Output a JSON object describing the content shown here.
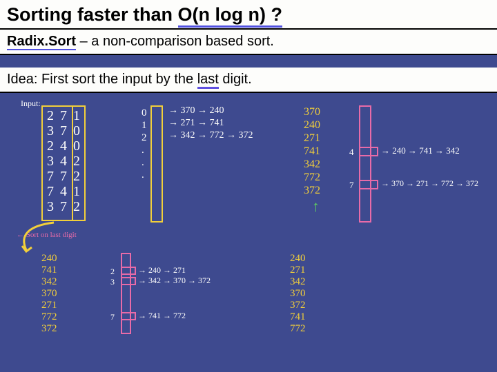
{
  "title_a": "Sorting faster than",
  "title_b": "O(n log n) ?",
  "sub_rs": "Radix.Sort",
  "sub_rest": " – a non-comparison based sort.",
  "idea_a": "Idea: First sort the input by the ",
  "idea_last": "last",
  "idea_b": " digit.",
  "input_label": "Input:",
  "input_nums": "2 7 1\n3 7 0\n2 4 0\n3 4 2\n7 7 2\n7 4 1\n3 7 2",
  "buckets1_idx": "0\n1\n2\n.\n.\n.",
  "b0": "370 → 240",
  "b1": "271 → 741",
  "b2": "342 → 772 → 372",
  "pass1_out": "370\n240\n271\n741\n342\n772\n372",
  "b4": "240 → 741 → 342",
  "b7": "370 → 271 → 772 → 372",
  "sort_note": "Sort on last digit",
  "pass2_in": "240\n741\n342\n370\n271\n772\n372",
  "p2_b2": "240 → 271",
  "p2_b3": "342 → 370 → 372",
  "p2_b7": "741 → 772",
  "p2_idx23": "2\n3",
  "p2_idx7": "7",
  "final_out": "240\n271\n342\n370\n372\n741\n772",
  "idx4": "4",
  "idx7b": "7"
}
